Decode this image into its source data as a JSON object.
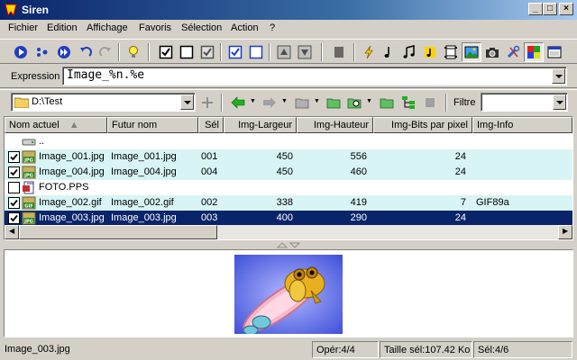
{
  "window": {
    "title": "Siren"
  },
  "menu": [
    "Fichier",
    "Edition",
    "Affichage",
    "Favoris",
    "Sélection",
    "Action",
    "?"
  ],
  "expression": {
    "label": "Expression",
    "value": "Image_%n.%e"
  },
  "path": {
    "value": "D:\\Test"
  },
  "filter": {
    "label": "Filtre",
    "value": ""
  },
  "columns": [
    "Nom actuel",
    "Futur nom",
    "Sél",
    "Img-Largeur",
    "Img-Hauteur",
    "Img-Bits par pixel",
    "Img-Info"
  ],
  "parent_entry": "..",
  "files": [
    {
      "name": "Image_001.jpg",
      "future": "Image_001.jpg",
      "sel": "001",
      "width": "450",
      "height": "556",
      "bits": "24",
      "info": "",
      "checked": true,
      "type": "jpg"
    },
    {
      "name": "Image_004.jpg",
      "future": "Image_004.jpg",
      "sel": "004",
      "width": "450",
      "height": "460",
      "bits": "24",
      "info": "",
      "checked": true,
      "type": "jpg"
    },
    {
      "name": "FOTO.PPS",
      "future": "",
      "sel": "",
      "width": "",
      "height": "",
      "bits": "",
      "info": "",
      "checked": false,
      "type": "pps"
    },
    {
      "name": "Image_002.gif",
      "future": "Image_002.gif",
      "sel": "002",
      "width": "338",
      "height": "419",
      "bits": "7",
      "info": "GIF89a",
      "checked": true,
      "type": "gif"
    },
    {
      "name": "Image_003.jpg",
      "future": "Image_003.jpg",
      "sel": "003",
      "width": "400",
      "height": "290",
      "bits": "24",
      "info": "",
      "checked": true,
      "type": "jpg",
      "selected": true
    }
  ],
  "status": {
    "file": "Image_003.jpg",
    "oper": "Opér:4/4",
    "size": "Taille sél:107.42 Ko",
    "sel": "Sél:4/6"
  },
  "colors": {
    "title_start": "#0a246a",
    "selection": "#0a246a",
    "alt_row": "#d8f4f4",
    "check_green": "#0b7a0b"
  }
}
